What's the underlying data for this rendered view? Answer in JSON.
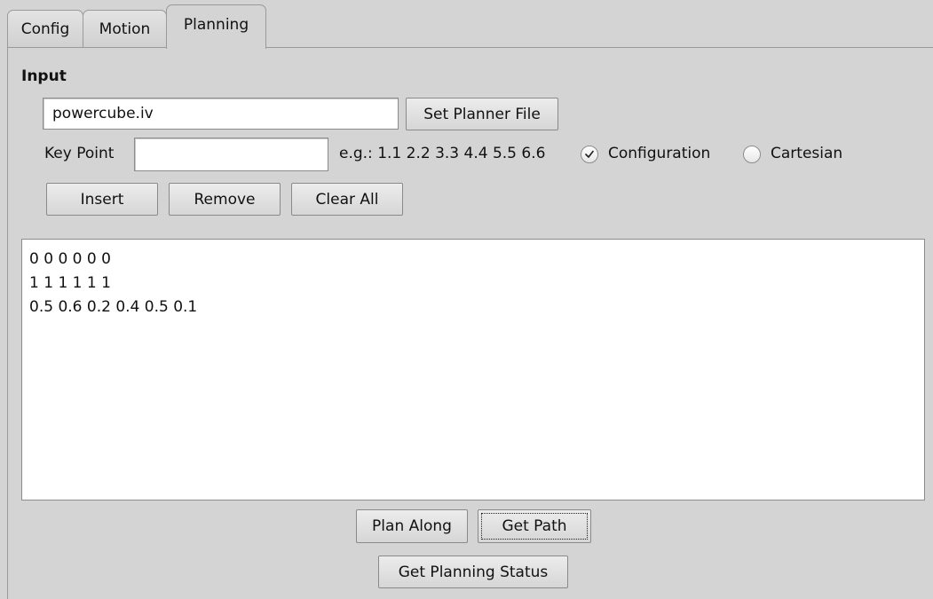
{
  "tabs": [
    {
      "label": "Config"
    },
    {
      "label": "Motion"
    },
    {
      "label": "Planning"
    }
  ],
  "input": {
    "section_label": "Input",
    "planner_file_value": "powercube.iv",
    "set_planner_file_label": "Set Planner File",
    "key_point_label": "Key Point",
    "key_point_value": "",
    "example_text": "e.g.: 1.1 2.2 3.3 4.4 5.5 6.6",
    "radio_configuration_label": "Configuration",
    "radio_configuration_checked": true,
    "radio_cartesian_label": "Cartesian",
    "radio_cartesian_checked": false,
    "insert_label": "Insert",
    "remove_label": "Remove",
    "clear_all_label": "Clear All"
  },
  "points": [
    "0 0 0 0 0 0",
    "1 1 1 1 1 1",
    "0.5 0.6 0.2 0.4 0.5 0.1"
  ],
  "actions": {
    "plan_along_label": "Plan Along",
    "get_path_label": "Get Path",
    "get_planning_status_label": "Get Planning Status"
  }
}
